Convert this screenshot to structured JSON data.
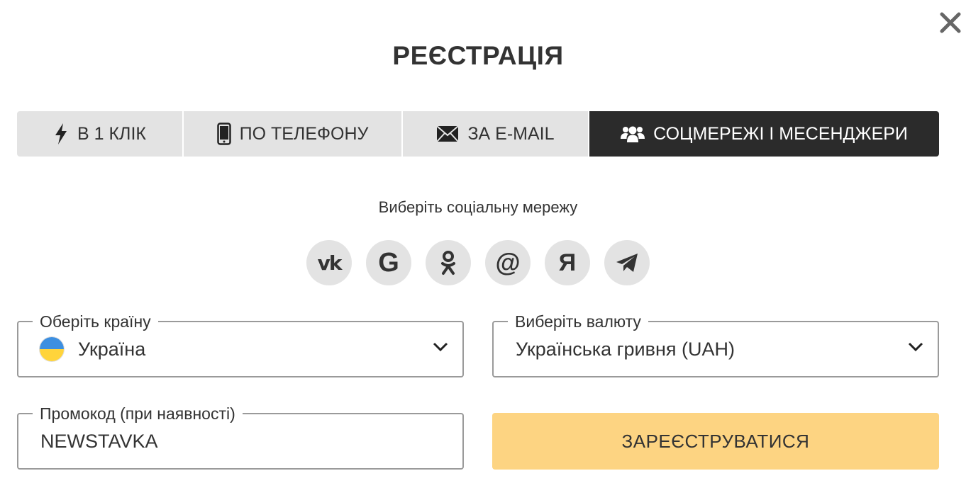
{
  "title": "РЕЄСТРАЦІЯ",
  "tabs": [
    {
      "label": "В 1 КЛІК",
      "icon": "lightning-icon",
      "active": false
    },
    {
      "label": "ПО ТЕЛЕФОНУ",
      "icon": "phone-icon",
      "active": false
    },
    {
      "label": "ЗА E-MAIL",
      "icon": "envelope-icon",
      "active": false
    },
    {
      "label": "СОЦМЕРЕЖІ І МЕСЕНДЖЕРИ",
      "icon": "users-icon",
      "active": true
    }
  ],
  "social": {
    "caption": "Виберіть соціальну мережу",
    "networks": [
      {
        "icon": "vk-icon",
        "glyph": "vk"
      },
      {
        "icon": "google-icon",
        "glyph": "G"
      },
      {
        "icon": "odnoklassniki-icon",
        "glyph": "ok"
      },
      {
        "icon": "mail-ru-icon",
        "glyph": "@"
      },
      {
        "icon": "yandex-icon",
        "glyph": "Я"
      },
      {
        "icon": "telegram-icon",
        "glyph": "tg"
      }
    ]
  },
  "country": {
    "label": "Оберіть країну",
    "value": "Україна",
    "flag_colors": [
      "#3d8fe0",
      "#ffd43b"
    ]
  },
  "currency": {
    "label": "Виберіть валюту",
    "value": "Українська гривня (UAH)"
  },
  "promo": {
    "label": "Промокод (при наявності)",
    "value": "NEWSTAVKA"
  },
  "register_label": "ЗАРЕЄСТРУВАТИСЯ",
  "colors": {
    "active_tab": "#2b2b2b",
    "tab": "#e3e3e3",
    "register_button": "#fdd482",
    "field_border": "#9a9a9a"
  }
}
